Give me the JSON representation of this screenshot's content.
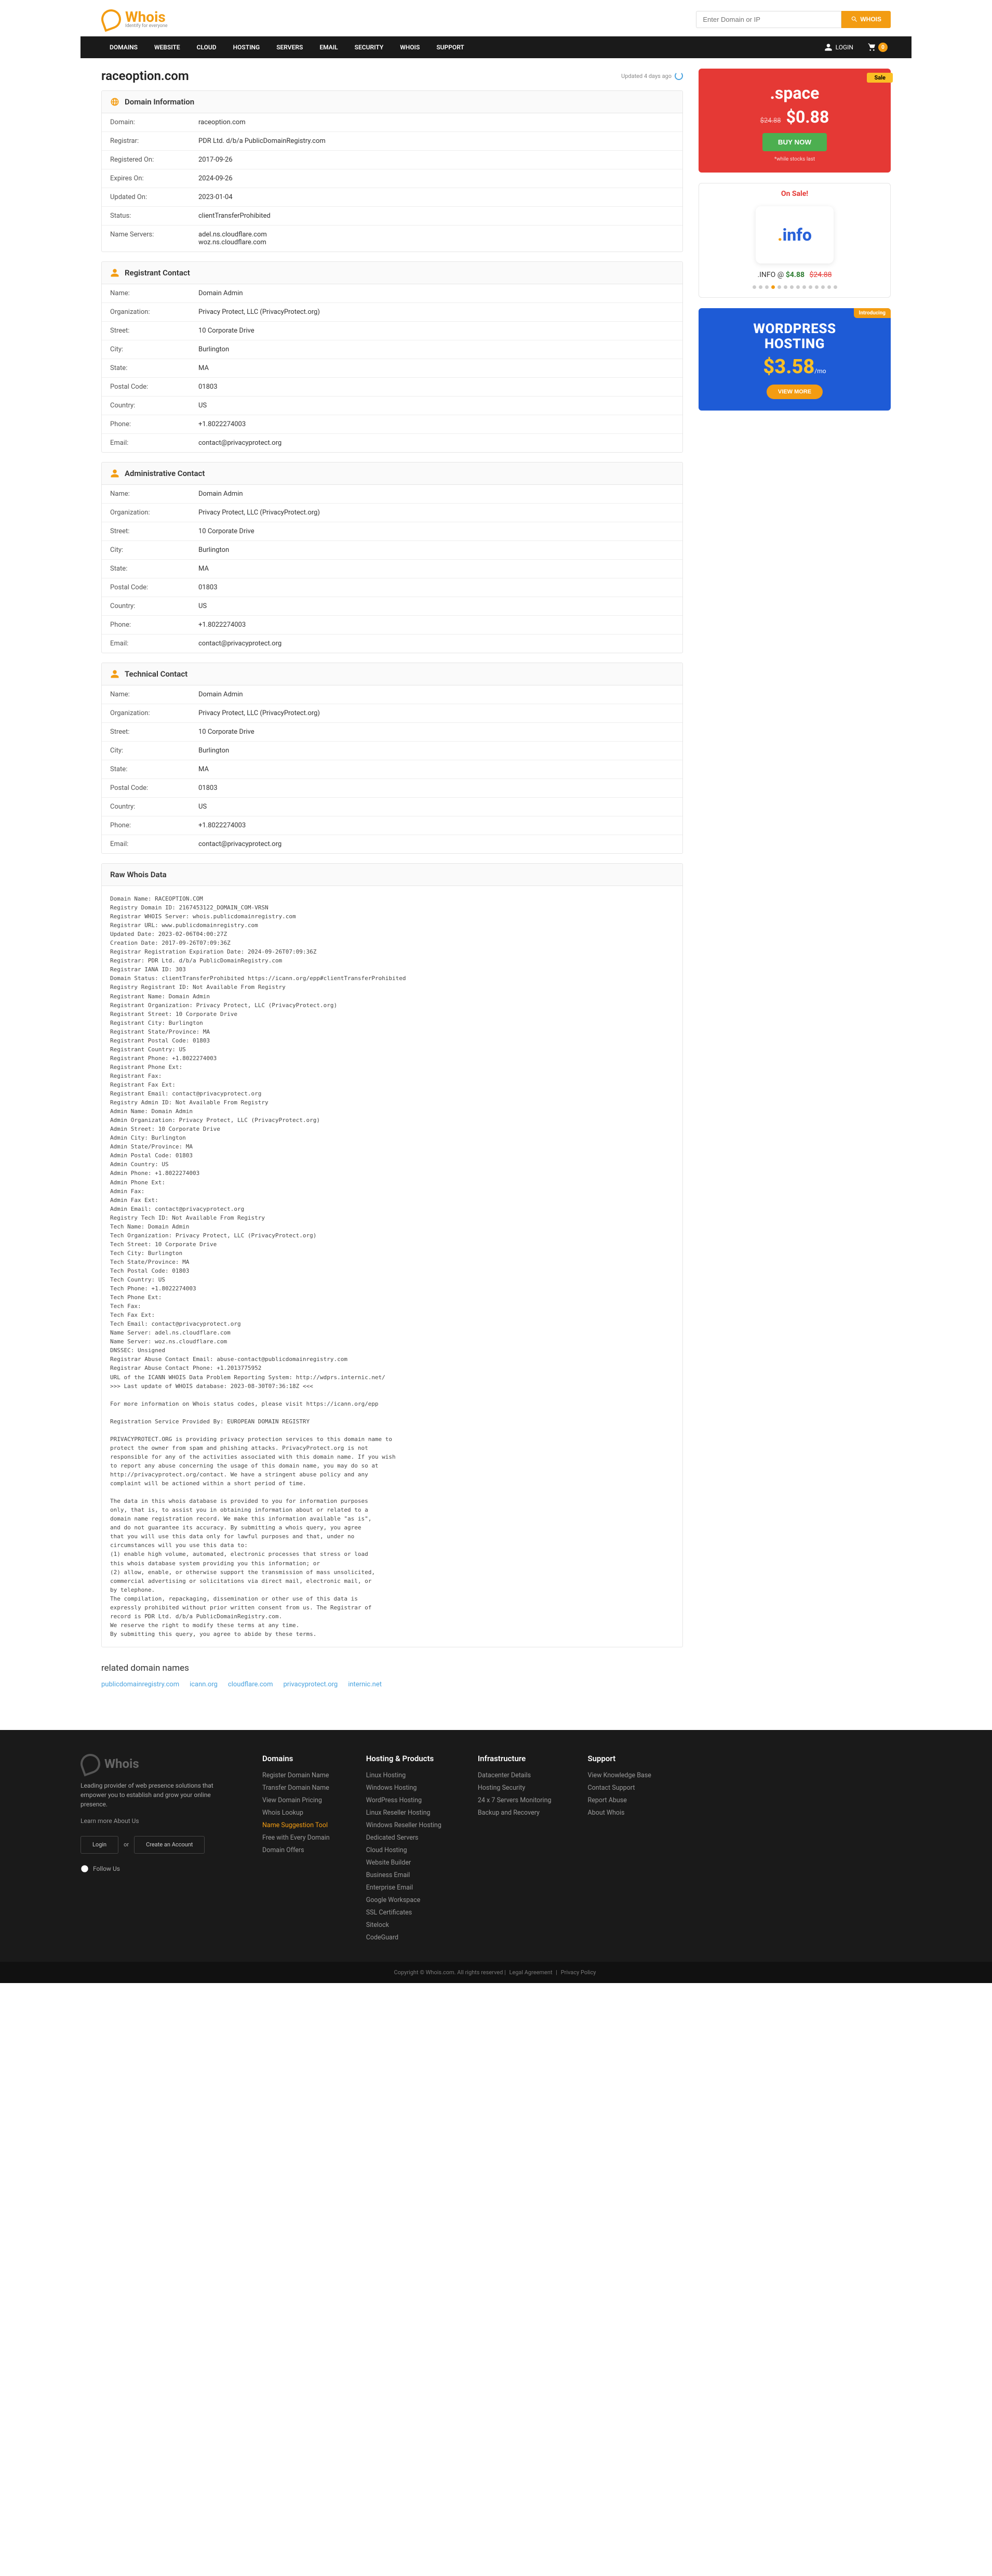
{
  "brand": {
    "name": "Whois",
    "tagline": "Identify for everyone"
  },
  "search": {
    "placeholder": "Enter Domain or IP",
    "btn": "WHOIS"
  },
  "nav": {
    "items": [
      "DOMAINS",
      "WEBSITE",
      "CLOUD",
      "HOSTING",
      "SERVERS",
      "EMAIL",
      "SECURITY",
      "WHOIS",
      "SUPPORT"
    ],
    "login": "LOGIN",
    "cart_count": "0"
  },
  "page": {
    "domain": "raceoption.com",
    "updated": "Updated 4 days ago"
  },
  "domain_info": {
    "title": "Domain Information",
    "rows": [
      {
        "k": "Domain:",
        "v": "raceoption.com"
      },
      {
        "k": "Registrar:",
        "v": "PDR Ltd. d/b/a PublicDomainRegistry.com"
      },
      {
        "k": "Registered On:",
        "v": "2017-09-26"
      },
      {
        "k": "Expires On:",
        "v": "2024-09-26"
      },
      {
        "k": "Updated On:",
        "v": "2023-01-04"
      },
      {
        "k": "Status:",
        "v": "clientTransferProhibited"
      },
      {
        "k": "Name Servers:",
        "v": "adel.ns.cloudflare.com\nwoz.ns.cloudflare.com"
      }
    ]
  },
  "registrant": {
    "title": "Registrant Contact",
    "rows": [
      {
        "k": "Name:",
        "v": "Domain Admin"
      },
      {
        "k": "Organization:",
        "v": "Privacy Protect, LLC (PrivacyProtect.org)"
      },
      {
        "k": "Street:",
        "v": "10 Corporate Drive"
      },
      {
        "k": "City:",
        "v": "Burlington"
      },
      {
        "k": "State:",
        "v": "MA"
      },
      {
        "k": "Postal Code:",
        "v": "01803"
      },
      {
        "k": "Country:",
        "v": "US"
      },
      {
        "k": "Phone:",
        "v": "+1.8022274003"
      },
      {
        "k": "Email:",
        "v": "contact@privacyprotect.org"
      }
    ]
  },
  "admin": {
    "title": "Administrative Contact",
    "rows": [
      {
        "k": "Name:",
        "v": "Domain Admin"
      },
      {
        "k": "Organization:",
        "v": "Privacy Protect, LLC (PrivacyProtect.org)"
      },
      {
        "k": "Street:",
        "v": "10 Corporate Drive"
      },
      {
        "k": "City:",
        "v": "Burlington"
      },
      {
        "k": "State:",
        "v": "MA"
      },
      {
        "k": "Postal Code:",
        "v": "01803"
      },
      {
        "k": "Country:",
        "v": "US"
      },
      {
        "k": "Phone:",
        "v": "+1.8022274003"
      },
      {
        "k": "Email:",
        "v": "contact@privacyprotect.org"
      }
    ]
  },
  "tech": {
    "title": "Technical Contact",
    "rows": [
      {
        "k": "Name:",
        "v": "Domain Admin"
      },
      {
        "k": "Organization:",
        "v": "Privacy Protect, LLC (PrivacyProtect.org)"
      },
      {
        "k": "Street:",
        "v": "10 Corporate Drive"
      },
      {
        "k": "City:",
        "v": "Burlington"
      },
      {
        "k": "State:",
        "v": "MA"
      },
      {
        "k": "Postal Code:",
        "v": "01803"
      },
      {
        "k": "Country:",
        "v": "US"
      },
      {
        "k": "Phone:",
        "v": "+1.8022274003"
      },
      {
        "k": "Email:",
        "v": "contact@privacyprotect.org"
      }
    ]
  },
  "raw": {
    "title": "Raw Whois Data",
    "text": "Domain Name: RACEOPTION.COM\nRegistry Domain ID: 2167453122_DOMAIN_COM-VRSN\nRegistrar WHOIS Server: whois.publicdomainregistry.com\nRegistrar URL: www.publicdomainregistry.com\nUpdated Date: 2023-02-06T04:00:27Z\nCreation Date: 2017-09-26T07:09:36Z\nRegistrar Registration Expiration Date: 2024-09-26T07:09:36Z\nRegistrar: PDR Ltd. d/b/a PublicDomainRegistry.com\nRegistrar IANA ID: 303\nDomain Status: clientTransferProhibited https://icann.org/epp#clientTransferProhibited\nRegistry Registrant ID: Not Available From Registry\nRegistrant Name: Domain Admin\nRegistrant Organization: Privacy Protect, LLC (PrivacyProtect.org)\nRegistrant Street: 10 Corporate Drive\nRegistrant City: Burlington\nRegistrant State/Province: MA\nRegistrant Postal Code: 01803\nRegistrant Country: US\nRegistrant Phone: +1.8022274003\nRegistrant Phone Ext:\nRegistrant Fax:\nRegistrant Fax Ext:\nRegistrant Email: contact@privacyprotect.org\nRegistry Admin ID: Not Available From Registry\nAdmin Name: Domain Admin\nAdmin Organization: Privacy Protect, LLC (PrivacyProtect.org)\nAdmin Street: 10 Corporate Drive\nAdmin City: Burlington\nAdmin State/Province: MA\nAdmin Postal Code: 01803\nAdmin Country: US\nAdmin Phone: +1.8022274003\nAdmin Phone Ext:\nAdmin Fax:\nAdmin Fax Ext:\nAdmin Email: contact@privacyprotect.org\nRegistry Tech ID: Not Available From Registry\nTech Name: Domain Admin\nTech Organization: Privacy Protect, LLC (PrivacyProtect.org)\nTech Street: 10 Corporate Drive\nTech City: Burlington\nTech State/Province: MA\nTech Postal Code: 01803\nTech Country: US\nTech Phone: +1.8022274003\nTech Phone Ext:\nTech Fax:\nTech Fax Ext:\nTech Email: contact@privacyprotect.org\nName Server: adel.ns.cloudflare.com\nName Server: woz.ns.cloudflare.com\nDNSSEC: Unsigned\nRegistrar Abuse Contact Email: abuse-contact@publicdomainregistry.com\nRegistrar Abuse Contact Phone: +1.2013775952\nURL of the ICANN WHOIS Data Problem Reporting System: http://wdprs.internic.net/\n>>> Last update of WHOIS database: 2023-08-30T07:36:18Z <<<\n\nFor more information on Whois status codes, please visit https://icann.org/epp\n\nRegistration Service Provided By: EUROPEAN DOMAIN REGISTRY\n\nPRIVACYPROTECT.ORG is providing privacy protection services to this domain name to\nprotect the owner from spam and phishing attacks. PrivacyProtect.org is not\nresponsible for any of the activities associated with this domain name. If you wish\nto report any abuse concerning the usage of this domain name, you may do so at\nhttp://privacyprotect.org/contact. We have a stringent abuse policy and any\ncomplaint will be actioned within a short period of time.\n\nThe data in this whois database is provided to you for information purposes\nonly, that is, to assist you in obtaining information about or related to a\ndomain name registration record. We make this information available \"as is\",\nand do not guarantee its accuracy. By submitting a whois query, you agree\nthat you will use this data only for lawful purposes and that, under no\ncircumstances will you use this data to:\n(1) enable high volume, automated, electronic processes that stress or load\nthis whois database system providing you this information; or\n(2) allow, enable, or otherwise support the transmission of mass unsolicited,\ncommercial advertising or solicitations via direct mail, electronic mail, or\nby telephone.\nThe compilation, repackaging, dissemination or other use of this data is\nexpressly prohibited without prior written consent from us. The Registrar of\nrecord is PDR Ltd. d/b/a PublicDomainRegistry.com.\nWe reserve the right to modify these terms at any time.\nBy submitting this query, you agree to abide by these terms."
  },
  "related": {
    "title": "related domain names",
    "links": [
      "publicdomainregistry.com",
      "icann.org",
      "cloudflare.com",
      "privacyprotect.org",
      "internic.net"
    ]
  },
  "promo_space": {
    "badge": "Sale",
    "tld": ".space",
    "old": "$24.88",
    "new": "$0.88",
    "btn": "BUY NOW",
    "fine": "*while stocks last"
  },
  "promo_info": {
    "onsale": "On Sale!",
    "dot": ".",
    "tld": "info",
    "label": ".INFO @",
    "price": "$4.88",
    "old": "$24.88"
  },
  "promo_wp": {
    "badge": "Introducing",
    "l1": "WORDPRESS",
    "l2": "HOSTING",
    "price": "$3.58",
    "unit": "/mo",
    "btn": "VIEW MORE"
  },
  "footer": {
    "about": {
      "lead": "Leading provider of web presence solutions that empower you to establish and grow your online presence.",
      "learn": "Learn more About Us",
      "login": "Login",
      "or": "or",
      "create": "Create an Account",
      "follow": "Follow Us"
    },
    "cols": [
      {
        "title": "Domains",
        "items": [
          "Register Domain Name",
          "Transfer Domain Name",
          "View Domain Pricing",
          "Whois Lookup",
          "Name Suggestion Tool",
          "Free with Every Domain",
          "Domain Offers"
        ],
        "hot": 4
      },
      {
        "title": "Hosting & Products",
        "items": [
          "Linux Hosting",
          "Windows Hosting",
          "WordPress Hosting",
          "Linux Reseller Hosting",
          "Windows Reseller Hosting",
          "Dedicated Servers",
          "Cloud Hosting",
          "Website Builder",
          "Business Email",
          "Enterprise Email",
          "Google Workspace",
          "SSL Certificates",
          "Sitelock",
          "CodeGuard"
        ]
      },
      {
        "title": "Infrastructure",
        "items": [
          "Datacenter Details",
          "Hosting Security",
          "24 x 7 Servers Monitoring",
          "Backup and Recovery"
        ]
      },
      {
        "title": "Support",
        "items": [
          "View Knowledge Base",
          "Contact Support",
          "Report Abuse",
          "About Whois"
        ]
      }
    ],
    "copy": {
      "text": "Copyright © Whois.com. All rights reserved",
      "l1": "Legal Agreement",
      "l2": "Privacy Policy"
    }
  }
}
